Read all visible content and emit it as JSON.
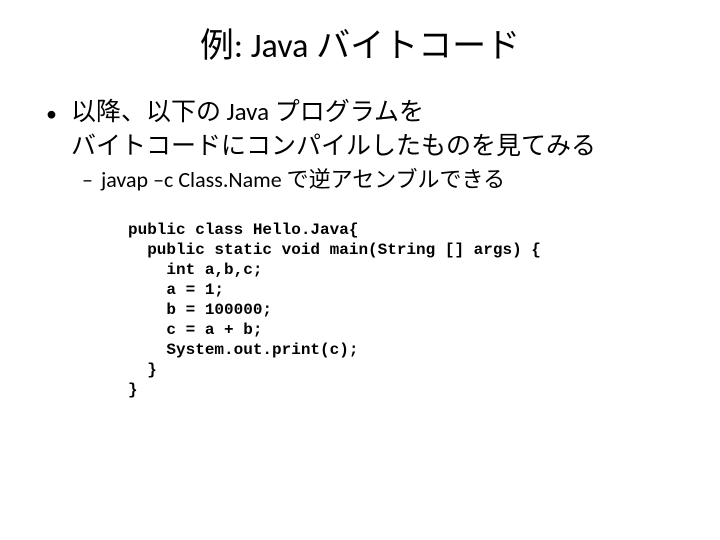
{
  "title": "例: Java バイトコード",
  "bullet1_line1": "以降、以下の Java プログラムを",
  "bullet1_line2": "バイトコードにコンパイルしたものを見てみる",
  "bullet2": "javap –c Class.Name で逆アセンブルできる",
  "code": "public class Hello.Java{\n  public static void main(String [] args) {\n    int a,b,c;\n    a = 1;\n    b = 100000;\n    c = a + b;\n    System.out.print(c);\n  }\n}"
}
